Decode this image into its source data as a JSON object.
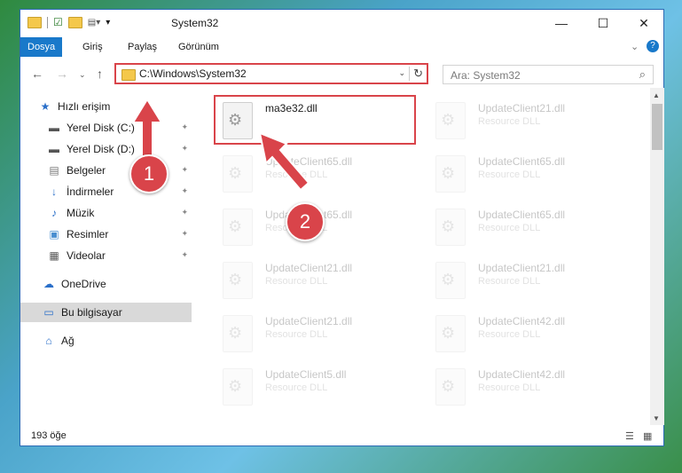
{
  "window": {
    "title": "System32",
    "minimize": "—",
    "maximize": "☐",
    "close": "✕"
  },
  "menu": {
    "items": [
      "Dosya",
      "Giriş",
      "Paylaş",
      "Görünüm"
    ],
    "help": "?",
    "expand": "⌄"
  },
  "address": {
    "path": "C:\\Windows\\System32",
    "dropdown": "⌄",
    "refresh": "↻"
  },
  "search": {
    "placeholder": "Ara: System32",
    "icon": "⌕"
  },
  "nav": {
    "items": [
      {
        "label": "Hızlı erişim",
        "icon": "★",
        "pinned": false
      },
      {
        "label": "Yerel Disk (C:)",
        "icon": "▬",
        "pinned": true
      },
      {
        "label": "Yerel Disk (D:)",
        "icon": "▬",
        "pinned": true
      },
      {
        "label": "Belgeler",
        "icon": "▤",
        "pinned": true
      },
      {
        "label": "İndirmeler",
        "icon": "↓",
        "pinned": true
      },
      {
        "label": "Müzik",
        "icon": "♪",
        "pinned": true
      },
      {
        "label": "Resimler",
        "icon": "▣",
        "pinned": true
      },
      {
        "label": "Videolar",
        "icon": "▦",
        "pinned": true
      },
      {
        "label": "OneDrive",
        "icon": "☁",
        "pinned": false
      },
      {
        "label": "Bu bilgisayar",
        "icon": "▭",
        "pinned": false
      },
      {
        "label": "Ağ",
        "icon": "⌂",
        "pinned": false
      }
    ],
    "pin_glyph": "📌"
  },
  "files": [
    {
      "name": "ma3e32.dll",
      "type": ""
    },
    {
      "name": "UpdateClient21.dll",
      "type": "Resource DLL"
    },
    {
      "name": "UpdateClient65.dll",
      "type": "Resource DLL"
    },
    {
      "name": "UpdateClient65.dll",
      "type": "Resource DLL"
    },
    {
      "name": "UpdateClient65.dll",
      "type": "Resource DLL"
    },
    {
      "name": "UpdateClient65.dll",
      "type": "Resource DLL"
    },
    {
      "name": "UpdateClient21.dll",
      "type": "Resource DLL"
    },
    {
      "name": "UpdateClient21.dll",
      "type": "Resource DLL"
    },
    {
      "name": "UpdateClient21.dll",
      "type": "Resource DLL"
    },
    {
      "name": "UpdateClient42.dll",
      "type": "Resource DLL"
    },
    {
      "name": "UpdateClient5.dll",
      "type": "Resource DLL"
    },
    {
      "name": "UpdateClient42.dll",
      "type": "Resource DLL"
    }
  ],
  "status": {
    "count": "193 öğe"
  },
  "callouts": {
    "badge1": "1",
    "badge2": "2"
  },
  "colors": {
    "highlight": "#d9444a",
    "accent": "#1979ca"
  }
}
